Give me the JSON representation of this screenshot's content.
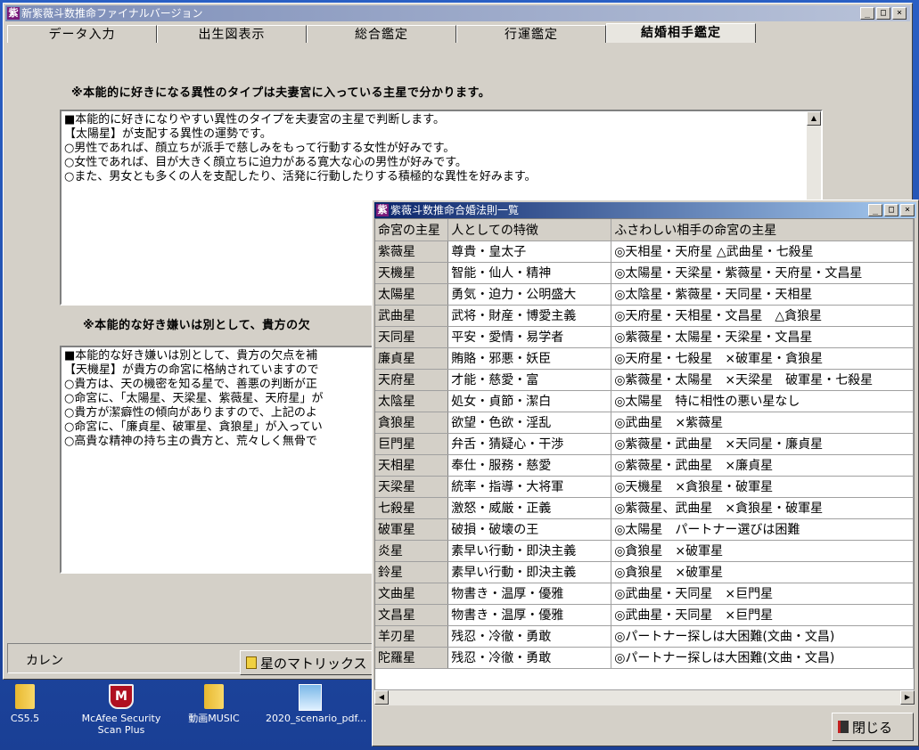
{
  "main_window": {
    "title": "新紫薇斗数推命ファイナルバージョン",
    "app_icon": "紫",
    "tabs": [
      "データ入力",
      "出生図表示",
      "総合鑑定",
      "行運鑑定",
      "結婚相手鑑定"
    ],
    "selected_tab": 4,
    "heading1": "※本能的に好きになる異性のタイプは夫妻宮に入っている主星で分かります。",
    "memo1": [
      "■本能的に好きになりやすい異性のタイプを夫妻宮の主星で判断します。",
      "【太陽星】が支配する異性の運勢です。",
      "○男性であれば、顔立ちが派手で慈しみをもって行動する女性が好みです。",
      "○女性であれば、目が大きく顔立ちに迫力がある寛大な心の男性が好みです。",
      "○また、男女とも多くの人を支配したり、活発に行動したりする積極的な異性を好みます。"
    ],
    "heading2": "※本能的な好き嫌いは別として、貴方の欠",
    "memo2": [
      "■本能的な好き嫌いは別として、貴方の欠点を補",
      "【天機星】が貴方の命宮に格納されていますので",
      "○貴方は、天の機密を知る星で、善悪の判断が正",
      "○命宮に、「太陽星、天梁星、紫薇星、天府星」が",
      "○貴方が潔癖性の傾向がありますので、上記のよ",
      "○命宮に、「廉貞星、破軍星、貪狼星」が入ってい",
      "○高貴な精神の持ち主の貴方と、荒々しく無骨で"
    ],
    "status_label": "カレン",
    "matrix_button": "星のマトリックス"
  },
  "popup": {
    "title": "紫薇斗数推命合婚法則一覧",
    "app_icon": "紫",
    "columns": [
      "命宮の主星",
      "人としての特徴",
      "ふさわしい相手の命宮の主星"
    ],
    "rows": [
      [
        "紫薇星",
        "尊貴・皇太子",
        "◎天相星・天府星 △武曲星・七殺星"
      ],
      [
        "天機星",
        "智能・仙人・精神",
        "◎太陽星・天梁星・紫薇星・天府星・文昌星"
      ],
      [
        "太陽星",
        "勇気・迫力・公明盛大",
        "◎太陰星・紫薇星・天同星・天相星"
      ],
      [
        "武曲星",
        "武将・財産・博愛主義",
        "◎天府星・天相星・文昌星　△貪狼星"
      ],
      [
        "天同星",
        "平安・愛情・易学者",
        "◎紫薇星・太陽星・天梁星・文昌星"
      ],
      [
        "廉貞星",
        "賄賂・邪悪・妖臣",
        "◎天府星・七殺星　×破軍星・貪狼星"
      ],
      [
        "天府星",
        "才能・慈愛・富",
        "◎紫薇星・太陽星　×天梁星　破軍星・七殺星"
      ],
      [
        "太陰星",
        "処女・貞節・潔白",
        "◎太陽星　特に相性の悪い星なし"
      ],
      [
        "貪狼星",
        "欲望・色欲・淫乱",
        "◎武曲星　×紫薇星"
      ],
      [
        "巨門星",
        "弁舌・猜疑心・干渉",
        "◎紫薇星・武曲星　×天同星・廉貞星"
      ],
      [
        "天相星",
        "奉仕・服務・慈愛",
        "◎紫薇星・武曲星　×廉貞星"
      ],
      [
        "天梁星",
        "統率・指導・大将軍",
        "◎天機星　×貪狼星・破軍星"
      ],
      [
        "七殺星",
        "激怒・威厳・正義",
        "◎紫薇星、武曲星　×貪狼星・破軍星"
      ],
      [
        "破軍星",
        "破損・破壊の王",
        "◎太陽星　パートナー選びは困難"
      ],
      [
        "炎星",
        "素早い行動・即決主義",
        "◎貪狼星　×破軍星"
      ],
      [
        "鈴星",
        "素早い行動・即決主義",
        "◎貪狼星　×破軍星"
      ],
      [
        "文曲星",
        "物書き・温厚・優雅",
        "◎武曲星・天同星　×巨門星"
      ],
      [
        "文昌星",
        "物書き・温厚・優雅",
        "◎武曲星・天同星　×巨門星"
      ],
      [
        "羊刃星",
        "残忍・冷徹・勇敢",
        "◎パートナー探しは大困難(文曲・文昌)"
      ],
      [
        "陀羅星",
        "残忍・冷徹・勇敢",
        "◎パートナー探しは大困難(文曲・文昌)"
      ]
    ],
    "close_button": "閉じる"
  },
  "desktop_icons": [
    {
      "label": "CS5.5",
      "icon": "folder-icon"
    },
    {
      "label": "McAfee Security Scan Plus",
      "icon": "mcafee-icon"
    },
    {
      "label": "動画MUSIC",
      "icon": "folder-icon"
    },
    {
      "label": "2020_scenario_pdf...",
      "icon": "pdf-file-icon"
    }
  ],
  "window_controls": {
    "minimize": "_",
    "maximize": "□",
    "close": "×"
  },
  "scroll_glyphs": {
    "up": "▲",
    "left": "◀",
    "right": "▶"
  }
}
